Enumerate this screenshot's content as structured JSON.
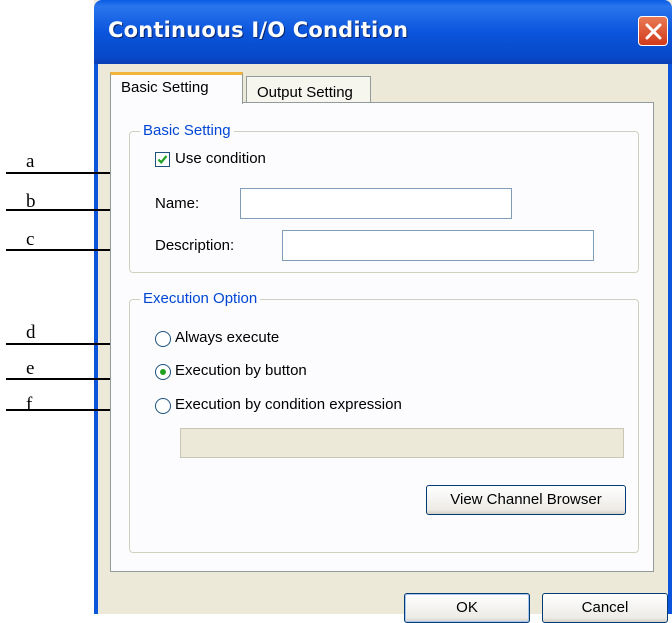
{
  "window": {
    "title": "Continuous I/O Condition"
  },
  "tabs": [
    {
      "label": "Basic Setting",
      "active": true
    },
    {
      "label": "Output Setting",
      "active": false
    }
  ],
  "basic_setting": {
    "legend": "Basic Setting",
    "use_condition": {
      "label": "Use condition",
      "checked": true
    },
    "name": {
      "label": "Name:",
      "value": ""
    },
    "description": {
      "label": "Description:",
      "value": ""
    }
  },
  "execution_option": {
    "legend": "Execution Option",
    "options": [
      {
        "label": "Always execute",
        "selected": false
      },
      {
        "label": "Execution by button",
        "selected": true
      },
      {
        "label": "Execution by condition expression",
        "selected": false
      }
    ],
    "expression_value": "",
    "view_channel_browser_label": "View Channel Browser"
  },
  "buttons": {
    "ok": "OK",
    "cancel": "Cancel"
  },
  "annotations": [
    "a",
    "b",
    "c",
    "d",
    "e",
    "f"
  ],
  "colors": {
    "titlebar": "#0a55dc",
    "group_legend": "#0046d5",
    "dialog_bg": "#ece9d8",
    "active_tab_accent": "#f3b33d",
    "radio_dot": "#21a121"
  }
}
